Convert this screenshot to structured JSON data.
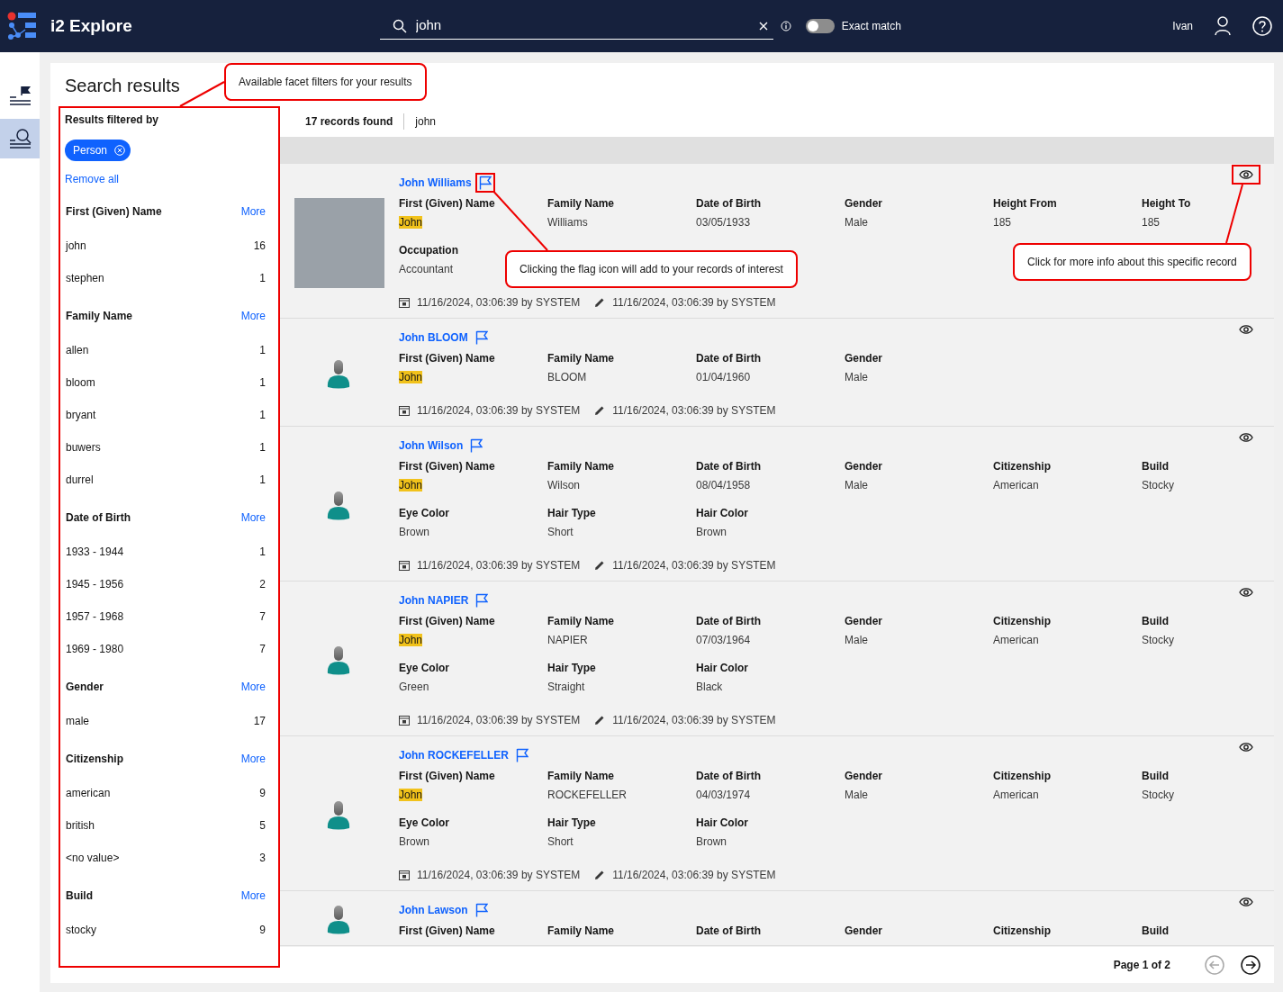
{
  "app": {
    "title": "i2 Explore"
  },
  "search": {
    "value": "john",
    "exact_match": {
      "label": "Exact match",
      "on": false
    }
  },
  "user": {
    "name": "Ivan"
  },
  "rail": [
    {
      "kind": "flagged",
      "selected": false
    },
    {
      "kind": "search",
      "selected": true
    }
  ],
  "page_title": "Search results",
  "facets": {
    "title": "Results filtered by",
    "chips": [
      {
        "label": "Person"
      }
    ],
    "remove_all": "Remove all",
    "groups": [
      {
        "title": "First (Given) Name",
        "more": "More",
        "items": [
          {
            "label": "john",
            "count": "16"
          },
          {
            "label": "stephen",
            "count": "1"
          }
        ]
      },
      {
        "title": "Family Name",
        "more": "More",
        "items": [
          {
            "label": "allen",
            "count": "1"
          },
          {
            "label": "bloom",
            "count": "1"
          },
          {
            "label": "bryant",
            "count": "1"
          },
          {
            "label": "buwers",
            "count": "1"
          },
          {
            "label": "durrel",
            "count": "1"
          }
        ]
      },
      {
        "title": "Date of Birth",
        "more": "More",
        "items": [
          {
            "label": "1933 - 1944",
            "count": "1"
          },
          {
            "label": "1945 - 1956",
            "count": "2"
          },
          {
            "label": "1957 - 1968",
            "count": "7"
          },
          {
            "label": "1969 - 1980",
            "count": "7"
          }
        ]
      },
      {
        "title": "Gender",
        "more": "More",
        "items": [
          {
            "label": "male",
            "count": "17"
          }
        ]
      },
      {
        "title": "Citizenship",
        "more": "More",
        "items": [
          {
            "label": "american",
            "count": "9"
          },
          {
            "label": "british",
            "count": "5"
          },
          {
            "label": "<no value>",
            "count": "3"
          }
        ]
      },
      {
        "title": "Build",
        "more": "More",
        "items": [
          {
            "label": "stocky",
            "count": "9"
          }
        ]
      }
    ]
  },
  "results": {
    "count": "17 records found",
    "query": "john",
    "records": [
      {
        "name": "John Williams",
        "avatar": {
          "kind": "photo"
        },
        "fields": [
          {
            "label": "First (Given) Name",
            "value": "John",
            "matched": true
          },
          {
            "label": "Family Name",
            "value": "Williams",
            "matched": false
          },
          {
            "label": "Date of Birth",
            "value": "03/05/1933",
            "matched": false
          },
          {
            "label": "Gender",
            "value": "Male",
            "matched": false
          },
          {
            "label": "Height From",
            "value": "185",
            "matched": false
          },
          {
            "label": "Height To",
            "value": "185",
            "matched": false
          },
          {
            "label": "Occupation",
            "value": "Accountant",
            "matched": false
          }
        ],
        "created": "11/16/2024, 03:06:39 by SYSTEM",
        "modified": "11/16/2024, 03:06:39 by SYSTEM"
      },
      {
        "name": "John BLOOM",
        "avatar": {
          "kind": "silhouette"
        },
        "fields": [
          {
            "label": "First (Given) Name",
            "value": "John",
            "matched": true
          },
          {
            "label": "Family Name",
            "value": "BLOOM",
            "matched": false
          },
          {
            "label": "Date of Birth",
            "value": "01/04/1960",
            "matched": false
          },
          {
            "label": "Gender",
            "value": "Male",
            "matched": false
          }
        ],
        "created": "11/16/2024, 03:06:39 by SYSTEM",
        "modified": "11/16/2024, 03:06:39 by SYSTEM"
      },
      {
        "name": "John Wilson",
        "avatar": {
          "kind": "silhouette"
        },
        "fields": [
          {
            "label": "First (Given) Name",
            "value": "John",
            "matched": true
          },
          {
            "label": "Family Name",
            "value": "Wilson",
            "matched": false
          },
          {
            "label": "Date of Birth",
            "value": "08/04/1958",
            "matched": false
          },
          {
            "label": "Gender",
            "value": "Male",
            "matched": false
          },
          {
            "label": "Citizenship",
            "value": "American",
            "matched": false
          },
          {
            "label": "Build",
            "value": "Stocky",
            "matched": false
          },
          {
            "label": "Eye Color",
            "value": "Brown",
            "matched": false
          },
          {
            "label": "Hair Type",
            "value": "Short",
            "matched": false
          },
          {
            "label": "Hair Color",
            "value": "Brown",
            "matched": false
          }
        ],
        "created": "11/16/2024, 03:06:39 by SYSTEM",
        "modified": "11/16/2024, 03:06:39 by SYSTEM"
      },
      {
        "name": "John NAPIER",
        "avatar": {
          "kind": "silhouette"
        },
        "fields": [
          {
            "label": "First (Given) Name",
            "value": "John",
            "matched": true
          },
          {
            "label": "Family Name",
            "value": "NAPIER",
            "matched": false
          },
          {
            "label": "Date of Birth",
            "value": "07/03/1964",
            "matched": false
          },
          {
            "label": "Gender",
            "value": "Male",
            "matched": false
          },
          {
            "label": "Citizenship",
            "value": "American",
            "matched": false
          },
          {
            "label": "Build",
            "value": "Stocky",
            "matched": false
          },
          {
            "label": "Eye Color",
            "value": "Green",
            "matched": false
          },
          {
            "label": "Hair Type",
            "value": "Straight",
            "matched": false
          },
          {
            "label": "Hair Color",
            "value": "Black",
            "matched": false
          }
        ],
        "created": "11/16/2024, 03:06:39 by SYSTEM",
        "modified": "11/16/2024, 03:06:39 by SYSTEM"
      },
      {
        "name": "John ROCKEFELLER",
        "avatar": {
          "kind": "silhouette"
        },
        "fields": [
          {
            "label": "First (Given) Name",
            "value": "John",
            "matched": true
          },
          {
            "label": "Family Name",
            "value": "ROCKEFELLER",
            "matched": false
          },
          {
            "label": "Date of Birth",
            "value": "04/03/1974",
            "matched": false
          },
          {
            "label": "Gender",
            "value": "Male",
            "matched": false
          },
          {
            "label": "Citizenship",
            "value": "American",
            "matched": false
          },
          {
            "label": "Build",
            "value": "Stocky",
            "matched": false
          },
          {
            "label": "Eye Color",
            "value": "Brown",
            "matched": false
          },
          {
            "label": "Hair Type",
            "value": "Short",
            "matched": false
          },
          {
            "label": "Hair Color",
            "value": "Brown",
            "matched": false
          }
        ],
        "created": "11/16/2024, 03:06:39 by SYSTEM",
        "modified": "11/16/2024, 03:06:39 by SYSTEM"
      },
      {
        "name": "John Lawson",
        "avatar": {
          "kind": "silhouette"
        },
        "fields": [
          {
            "label": "First (Given) Name"
          },
          {
            "label": "Family Name"
          },
          {
            "label": "Date of Birth"
          },
          {
            "label": "Gender"
          },
          {
            "label": "Citizenship"
          },
          {
            "label": "Build"
          }
        ]
      }
    ]
  },
  "pager": {
    "label": "Page 1 of 2",
    "prev_enabled": false,
    "next_enabled": true
  },
  "annotations": [
    {
      "kind": "facets",
      "text": "Available facet filters for your results"
    },
    {
      "kind": "flag",
      "text": "Clicking the flag icon will add to your records of interest"
    },
    {
      "kind": "view",
      "text": "Click for more info about this specific record"
    }
  ]
}
